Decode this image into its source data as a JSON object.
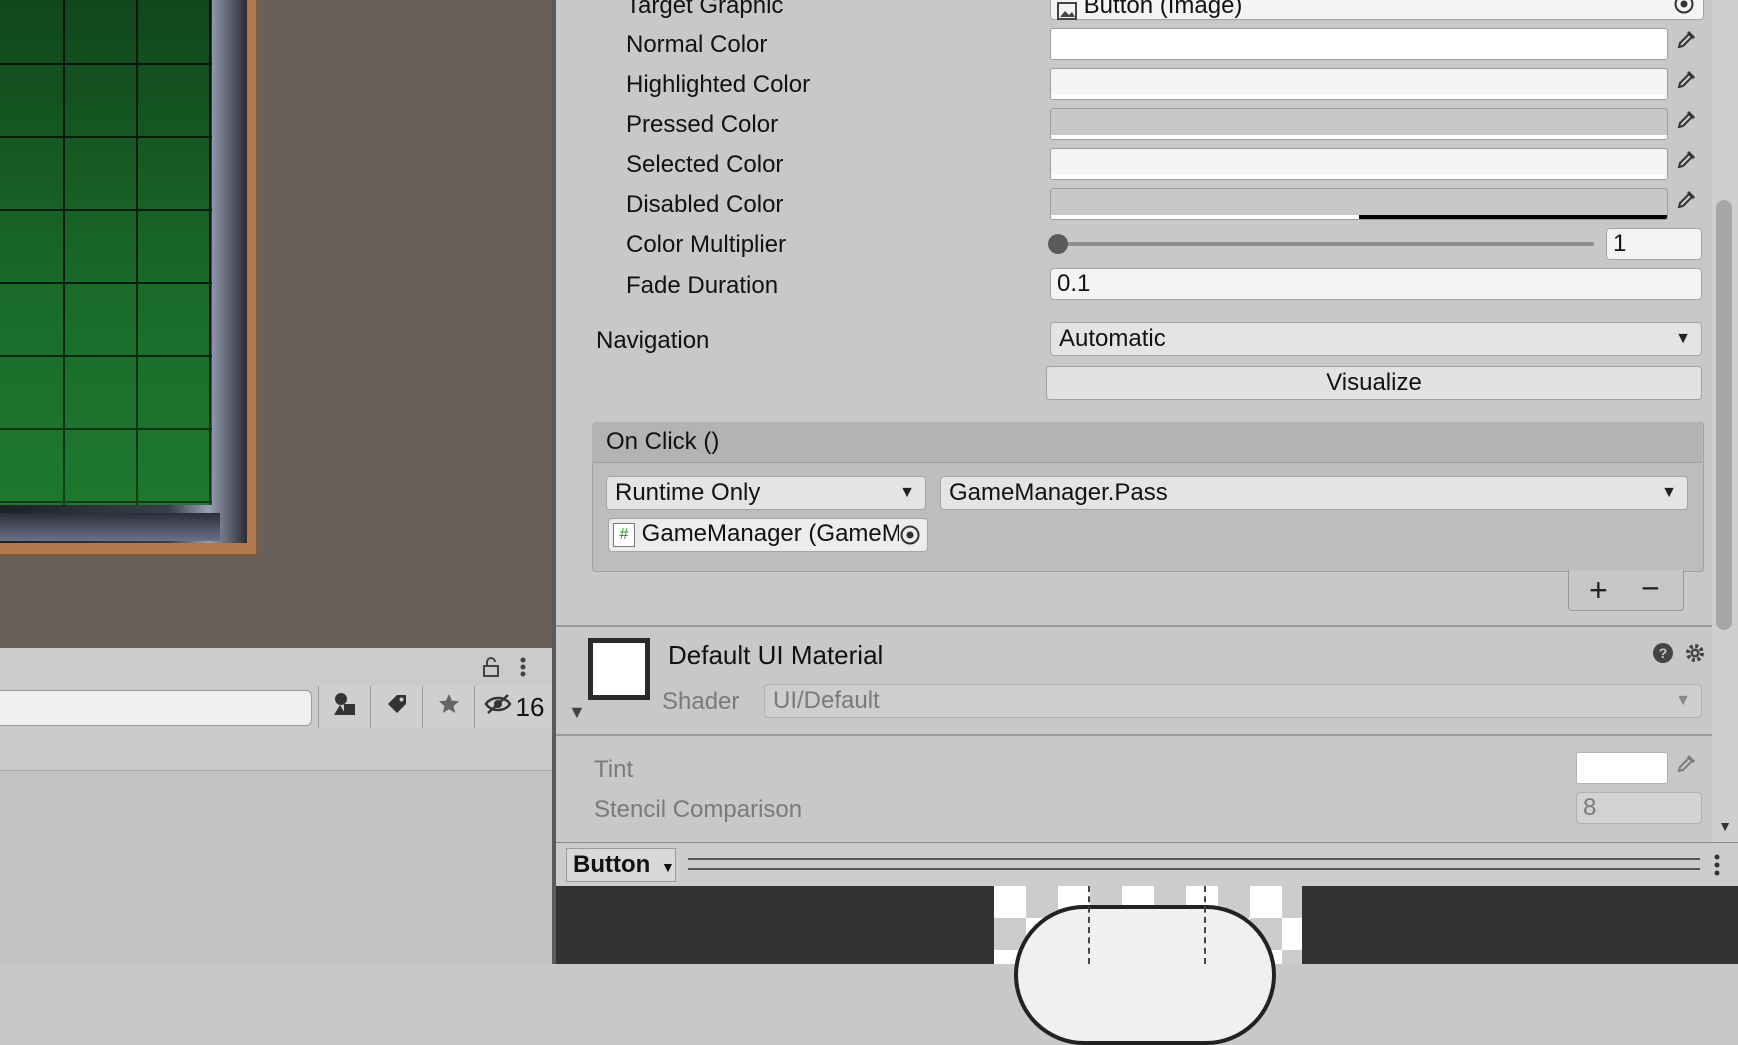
{
  "scene": {},
  "left_panel": {
    "hidden_count": "16"
  },
  "inspector": {
    "target_graphic": {
      "label": "Target Graphic",
      "value": "Button (Image)"
    },
    "normal_color": {
      "label": "Normal Color",
      "color": "#ffffff"
    },
    "highlighted_color": {
      "label": "Highlighted Color",
      "color": "#f5f5f5"
    },
    "pressed_color": {
      "label": "Pressed Color",
      "color": "#c8c8c8"
    },
    "selected_color": {
      "label": "Selected Color",
      "color": "#f5f5f5"
    },
    "disabled_color": {
      "label": "Disabled Color",
      "color": "#c8c8c8"
    },
    "color_multiplier": {
      "label": "Color Multiplier",
      "value": "1",
      "slider_fraction": 0.0
    },
    "fade_duration": {
      "label": "Fade Duration",
      "value": "0.1"
    },
    "navigation": {
      "label": "Navigation",
      "value": "Automatic"
    },
    "visualize_label": "Visualize",
    "on_click": {
      "header": "On Click ()",
      "runtime": "Runtime Only",
      "function": "GameManager.Pass",
      "object": "GameManager (GameM"
    },
    "material": {
      "title": "Default UI Material",
      "shader_label": "Shader",
      "shader_value": "UI/Default",
      "tint_label": "Tint",
      "stencil_comparison_label": "Stencil Comparison",
      "stencil_comparison_value": "8"
    }
  },
  "preview": {
    "title": "Button"
  }
}
